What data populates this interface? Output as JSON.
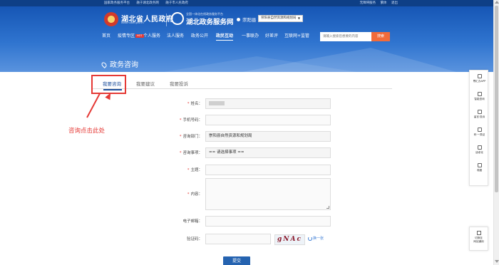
{
  "topbar": {
    "left_links": [
      "国家政务服务平台",
      "融于湖北政务网",
      "融于市人民政府"
    ],
    "right_links": [
      "无障碍服务",
      "繁体",
      "退出"
    ]
  },
  "header": {
    "gov_name": "湖北省人民政府",
    "gov_url": "www.hubei.gov.cn",
    "platform_sub": "全国一体化在线政务服务平台",
    "platform_name": "湖北政务服务网",
    "region": "崇阳县",
    "dept_select": "崇阳县自然资源和规划局"
  },
  "nav": {
    "items": [
      {
        "label": "首页"
      },
      {
        "label": "疫情专区",
        "badge": "HOT"
      },
      {
        "label": "个人服务"
      },
      {
        "label": "法人服务"
      },
      {
        "label": "政务公开"
      },
      {
        "label": "政民互动",
        "active": true
      },
      {
        "label": "一事联办"
      },
      {
        "label": "好差评"
      },
      {
        "label": "互联网+监管"
      }
    ]
  },
  "search": {
    "placeholder": "请输入搜索您想要的内容",
    "button": "搜索"
  },
  "page_title": "政务咨询",
  "tabs": [
    {
      "label": "我要咨询",
      "active": true
    },
    {
      "label": "我要建议"
    },
    {
      "label": "我要投诉"
    }
  ],
  "annotation": "咨询点击此处",
  "form": {
    "name_label": "姓名：",
    "phone_label": "手机号码：",
    "dept_label": "咨询部门：",
    "dept_value": "崇阳县自然资源和规划局",
    "matter_label": "咨询事项：",
    "matter_value": "== 请选择事项 ==",
    "subject_label": "主题：",
    "content_label": "内容：",
    "email_label": "电子邮箱：",
    "captcha_label": "验证码：",
    "captcha_text": "gNAc",
    "refresh_label": "换一张",
    "submit_label": "提交"
  },
  "sidebar": {
    "items": [
      "鄂汇办APP",
      "智能咨询",
      "留言·投诉",
      "码·一类证",
      "适老化",
      "收藏"
    ],
    "bottom": [
      "切换至",
      "网站通用"
    ]
  },
  "colors": {
    "header_blue": "#1656b5",
    "accent_blue": "#1d4f9b",
    "annotation_red": "#e53935",
    "search_orange": "#f26b3a"
  }
}
